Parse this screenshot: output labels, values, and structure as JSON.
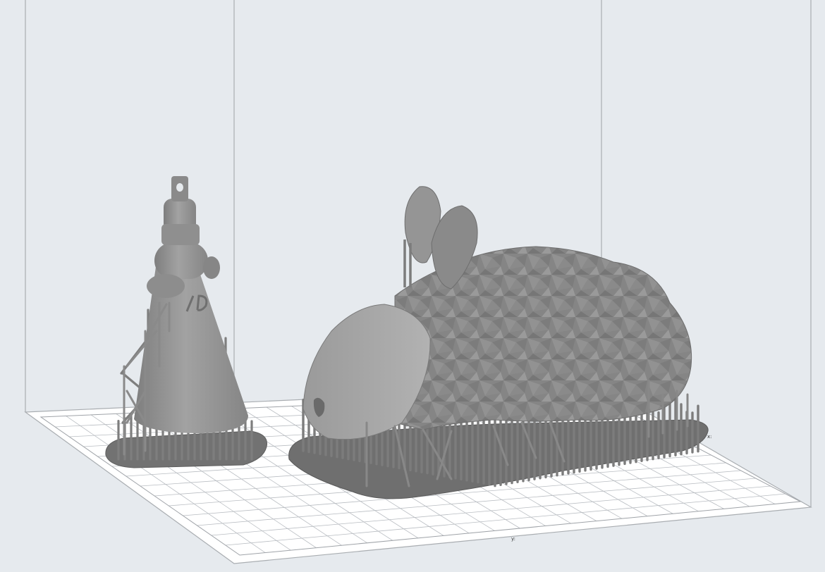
{
  "app": {
    "view": "3d-print-preview-viewport"
  },
  "scene": {
    "background_color": "#e6eaee",
    "build_volume_frame_color": "#a9adb1",
    "grid_color": "#b9bdc2",
    "plate_color": "#ffffff",
    "model_color": "#8d8d8d",
    "support_color": "#7b7b7b",
    "models": [
      {
        "name": "rocket-with-keyring-loop",
        "has_supports": true
      },
      {
        "name": "low-poly-bunny",
        "has_supports": true
      }
    ],
    "plate_labels": [
      {
        "text": "x:"
      },
      {
        "text": "y:"
      }
    ]
  }
}
